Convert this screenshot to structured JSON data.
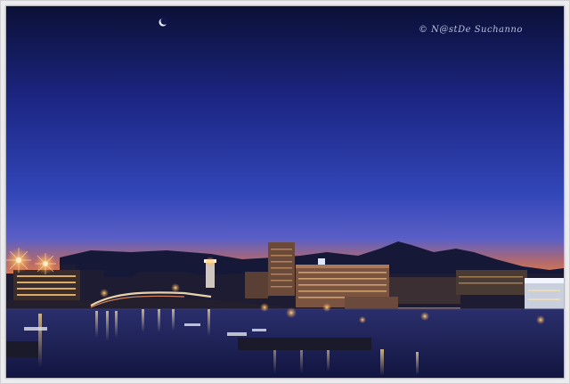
{
  "photo": {
    "subject": "Harbour town at blue hour",
    "watermark_text": "© N@stDe Suchanno",
    "colors": {
      "sky_top": "#0d1340",
      "sky_mid": "#2a3aa8",
      "sky_horizon": "#4b5fd2",
      "horizon_glow": "#c56a4f",
      "mountains": "#18193a",
      "water": "#1a1f55",
      "light": "#ffd27a"
    }
  }
}
